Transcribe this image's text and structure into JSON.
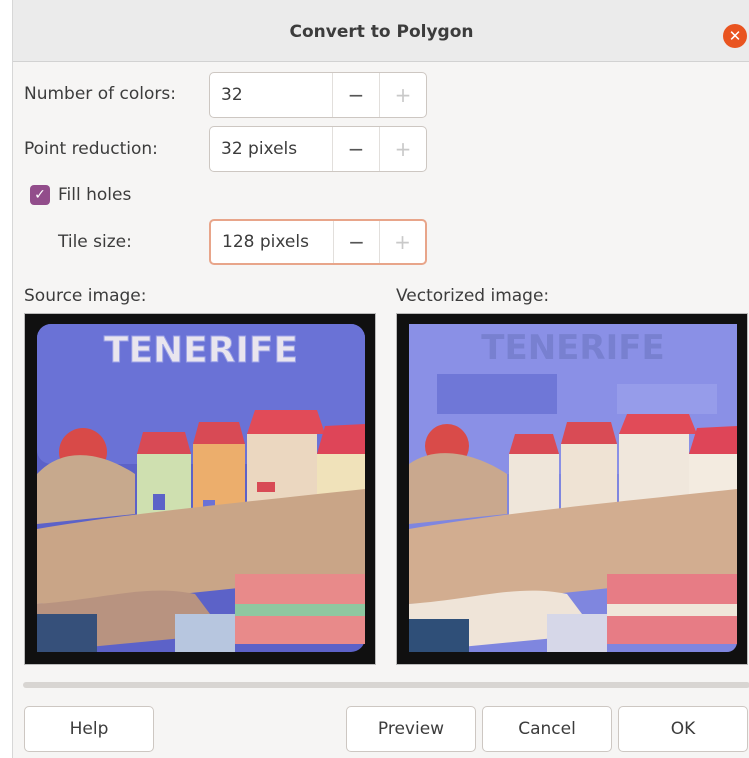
{
  "dialog": {
    "title": "Convert to Polygon",
    "close_icon": "close-icon"
  },
  "fields": {
    "number_of_colors": {
      "label": "Number of colors:",
      "value": "32"
    },
    "point_reduction": {
      "label": "Point reduction:",
      "value": "32 pixels"
    },
    "fill_holes": {
      "label": "Fill holes",
      "checked": true
    },
    "tile_size": {
      "label": "Tile size:",
      "value": "128 pixels"
    }
  },
  "stepper": {
    "minus": "−",
    "plus": "+"
  },
  "images": {
    "source_label": "Source image:",
    "vectorized_label": "Vectorized image:",
    "tile_text": "TENERIFE"
  },
  "buttons": {
    "help": "Help",
    "preview": "Preview",
    "cancel": "Cancel",
    "ok": "OK"
  },
  "colors": {
    "accent": "#e95420",
    "checkbox": "#924d8b",
    "focus_border": "#e8a58a"
  }
}
